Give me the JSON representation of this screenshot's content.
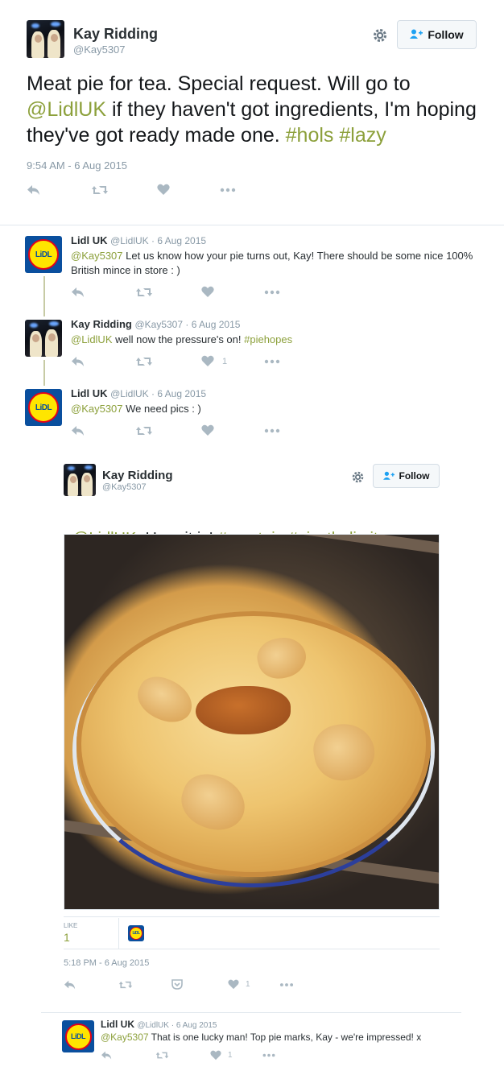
{
  "main_tweet": {
    "display_name": "Kay Ridding",
    "handle": "@Kay5307",
    "follow_label": "Follow",
    "text_parts": [
      "Meat pie for tea. Special request. Will go to ",
      "@LidlUK",
      " if they haven't got ingredients, I'm hoping they've got ready made one. ",
      "#hols",
      " ",
      "#lazy"
    ],
    "timestamp": "9:54 AM - 6 Aug 2015"
  },
  "replies": [
    {
      "display_name": "Lidl UK",
      "meta": "@LidlUK · 6 Aug 2015",
      "mention": "@Kay5307",
      "text": " Let us know how your pie turns out, Kay! There should be some nice 100% British mince in store : )",
      "like_count": ""
    },
    {
      "display_name": "Kay Ridding",
      "meta": "@Kay5307 · 6 Aug 2015",
      "mention": "@LidlUK",
      "text": " well now the pressure's on! ",
      "hashtag": "#piehopes",
      "like_count": "1"
    },
    {
      "display_name": "Lidl UK",
      "meta": "@LidlUK · 6 Aug 2015",
      "mention": "@Kay5307",
      "text": " We need pics : )",
      "like_count": ""
    }
  ],
  "embedded_tweet": {
    "display_name": "Kay Ridding",
    "handle": "@Kay5307",
    "follow_label": "Follow",
    "mention": "@LidlUK",
    "text": "  Here it is! ",
    "hashtags": [
      "#meatpie",
      "#piesthelimit"
    ],
    "likes_label": "LIKE",
    "likes_count": "1",
    "timestamp": "5:18 PM - 6 Aug 2015",
    "like_count": "1"
  },
  "last_reply": {
    "display_name": "Lidl UK",
    "meta": "@LidlUK · 6 Aug 2015",
    "mention": "@Kay5307",
    "text": " That is one lucky man! Top pie marks, Kay - we're impressed! x",
    "like_count": "1"
  },
  "lidl_logo_text": "LiDL",
  "icons": {
    "reply": "reply-icon",
    "retweet": "retweet-icon",
    "like": "heart-icon",
    "more": "more-icon",
    "settings": "gear-icon",
    "follow": "follow-person-icon",
    "pocket": "pocket-icon"
  },
  "colors": {
    "link": "#8ca03b",
    "muted": "#8899a6",
    "action": "#aab8c2"
  }
}
